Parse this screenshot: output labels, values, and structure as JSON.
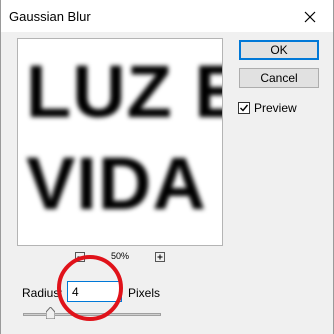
{
  "dialog": {
    "title": "Gaussian Blur",
    "close_icon": "close-icon"
  },
  "preview_image": {
    "line1": "LUZ E",
    "line2": "VIDA"
  },
  "buttons": {
    "ok_label": "OK",
    "cancel_label": "Cancel"
  },
  "preview_toggle": {
    "label": "Preview",
    "checked": true
  },
  "zoom": {
    "value": "50%",
    "minus_icon": "zoom-out-icon",
    "plus_icon": "zoom-in-icon"
  },
  "radius": {
    "label": "Radius:",
    "value": "4",
    "unit": "Pixels",
    "slider_level": 0.2
  },
  "annotation": {
    "color": "#e0121a"
  }
}
